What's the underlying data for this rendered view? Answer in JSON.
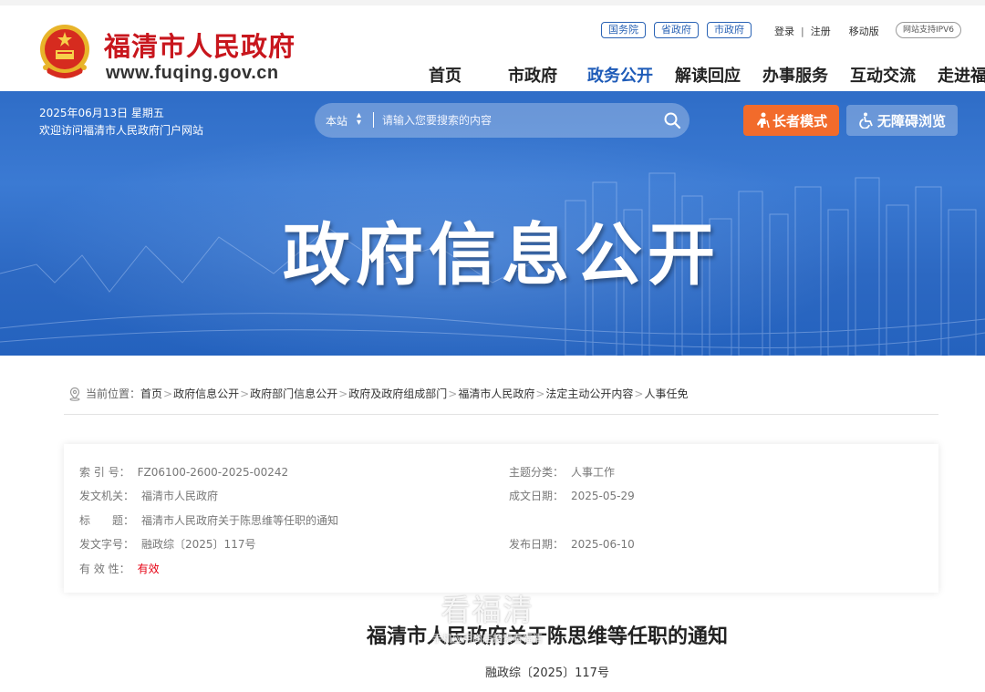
{
  "header": {
    "site_name": "福清市人民政府",
    "site_url": "www.fuqing.gov.cn",
    "gov_links": [
      "国务院",
      "省政府",
      "市政府"
    ],
    "login": "登录",
    "register": "注册",
    "mobile": "移动版",
    "ipv6": "网站支持IPV6",
    "nav": [
      {
        "label": "首页",
        "active": false
      },
      {
        "label": "市政府",
        "active": false
      },
      {
        "label": "政务公开",
        "active": true
      },
      {
        "label": "解读回应",
        "active": false
      },
      {
        "label": "办事服务",
        "active": false
      },
      {
        "label": "互动交流",
        "active": false
      },
      {
        "label": "走进福清",
        "active": false
      }
    ]
  },
  "banner": {
    "date": "2025年06月13日 星期五",
    "welcome": "欢迎访问福清市人民政府门户网站",
    "search_scope": "本站",
    "search_placeholder": "请输入您要搜索的内容",
    "elder_mode": "长者模式",
    "accessible": "无障碍浏览",
    "title": "政府信息公开"
  },
  "breadcrumb": {
    "prefix": "当前位置：",
    "items": [
      "首页",
      "政府信息公开",
      "政府部门信息公开",
      "政府及政府组成部门",
      "福清市人民政府",
      "法定主动公开内容",
      "人事任免"
    ]
  },
  "info": {
    "index_label": "索 引 号：",
    "index_value": "FZ06100-2600-2025-00242",
    "topic_label": "主题分类：",
    "topic_value": "人事工作",
    "issuer_label": "发文机关：",
    "issuer_value": "福清市人民政府",
    "date_label": "成文日期：",
    "date_value": "2025-05-29",
    "title_label": "标　　题：",
    "title_value": "福清市人民政府关于陈思维等任职的通知",
    "docno_label": "发文字号：",
    "docno_value": "融政综〔2025〕117号",
    "pubdate_label": "发布日期：",
    "pubdate_value": "2025-06-10",
    "validity_label": "有 效 性：",
    "validity_value": "有效"
  },
  "document": {
    "title": "福清市人民政府关于陈思维等任职的通知",
    "number": "融政综〔2025〕117号"
  },
  "watermark": {
    "line1": "看福清",
    "line2": "手机应用商店搜索看福清"
  },
  "colors": {
    "brand_red": "#c8161d",
    "nav_active": "#1e5bb8",
    "banner_blue": "#2f6dc7",
    "elder_orange": "#f26b2b",
    "validity_red": "#e60012"
  }
}
